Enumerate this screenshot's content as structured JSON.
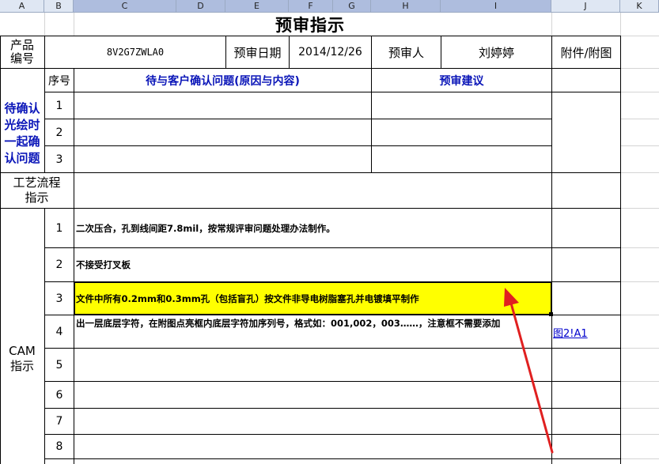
{
  "columns": [
    "A",
    "B",
    "C",
    "D",
    "E",
    "F",
    "G",
    "H",
    "I",
    "J",
    "K"
  ],
  "title": "预审指示",
  "info_row": {
    "product_label": "产品\n编号",
    "product_value": "8V2G7ZWLA0",
    "date_label": "预审日期",
    "date_value": "2014/12/26",
    "reviewer_label": "预审人",
    "reviewer_value": "刘婷婷",
    "attachment_label": "附件/附图"
  },
  "confirm": {
    "side_label": "待确认\n光绘时\n一起确\n认问题",
    "seq_header": "序号",
    "issue_header": "待与客户确认问题(原因与内容)",
    "advice_header": "预审建议",
    "rows": [
      "1",
      "2",
      "3"
    ]
  },
  "process": {
    "label": "工艺流程\n指示"
  },
  "cam": {
    "side_label": "CAM\n指示",
    "rows": [
      {
        "no": "1",
        "text": "二次压合，孔到线间距7.8mil，按常规评审问题处理办法制作。",
        "link": ""
      },
      {
        "no": "2",
        "text": "不接受打叉板",
        "link": ""
      },
      {
        "no": "3",
        "text": "文件中所有0.2mm和0.3mm孔（包括盲孔）按文件非导电树脂塞孔并电镀填平制作",
        "link": ""
      },
      {
        "no": "4",
        "text": "出一层底层字符，在附图点亮框内底层字符加序列号，格式如：001,002，003……，注意框不需要添加",
        "link": "图2!A1"
      },
      {
        "no": "5",
        "text": "",
        "link": ""
      },
      {
        "no": "6",
        "text": "",
        "link": ""
      },
      {
        "no": "7",
        "text": "",
        "link": ""
      },
      {
        "no": "8",
        "text": "",
        "link": ""
      }
    ]
  },
  "colors": {
    "highlight": "#ffff00",
    "header_blue": "#0a15b8",
    "arrow": "#e02020",
    "col_header_bg": "#dfe7f3"
  }
}
